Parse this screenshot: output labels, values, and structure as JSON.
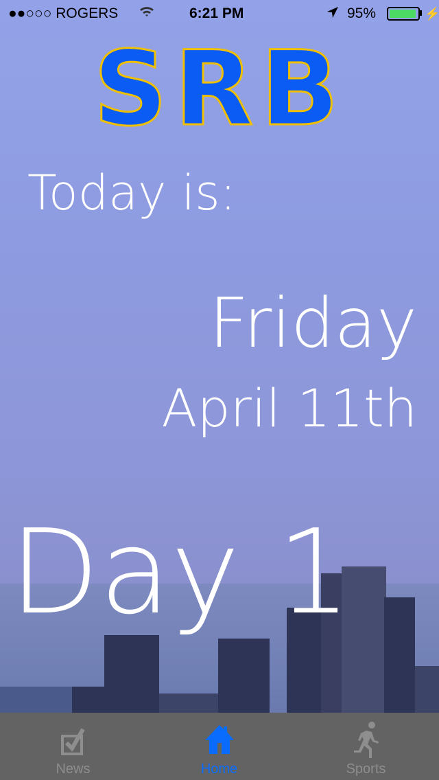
{
  "status": {
    "carrier": "●●○○○ ROGERS",
    "time": "6:21 PM",
    "battery": "95%",
    "battery_level": 0.95
  },
  "logo": "SRB",
  "main": {
    "today_label": "Today is:",
    "weekday": "Friday",
    "date": "April 11th",
    "day_cycle": "Day 1"
  },
  "tabs": [
    {
      "label": "News",
      "icon": "checkbox-icon"
    },
    {
      "label": "Home",
      "icon": "house-icon",
      "active": true
    },
    {
      "label": "Sports",
      "icon": "runner-icon"
    }
  ],
  "colors": {
    "accent": "#0a6cff",
    "logo_fill": "#0a5cf5",
    "logo_outline": "#f0c000",
    "battery": "#4cd964"
  }
}
